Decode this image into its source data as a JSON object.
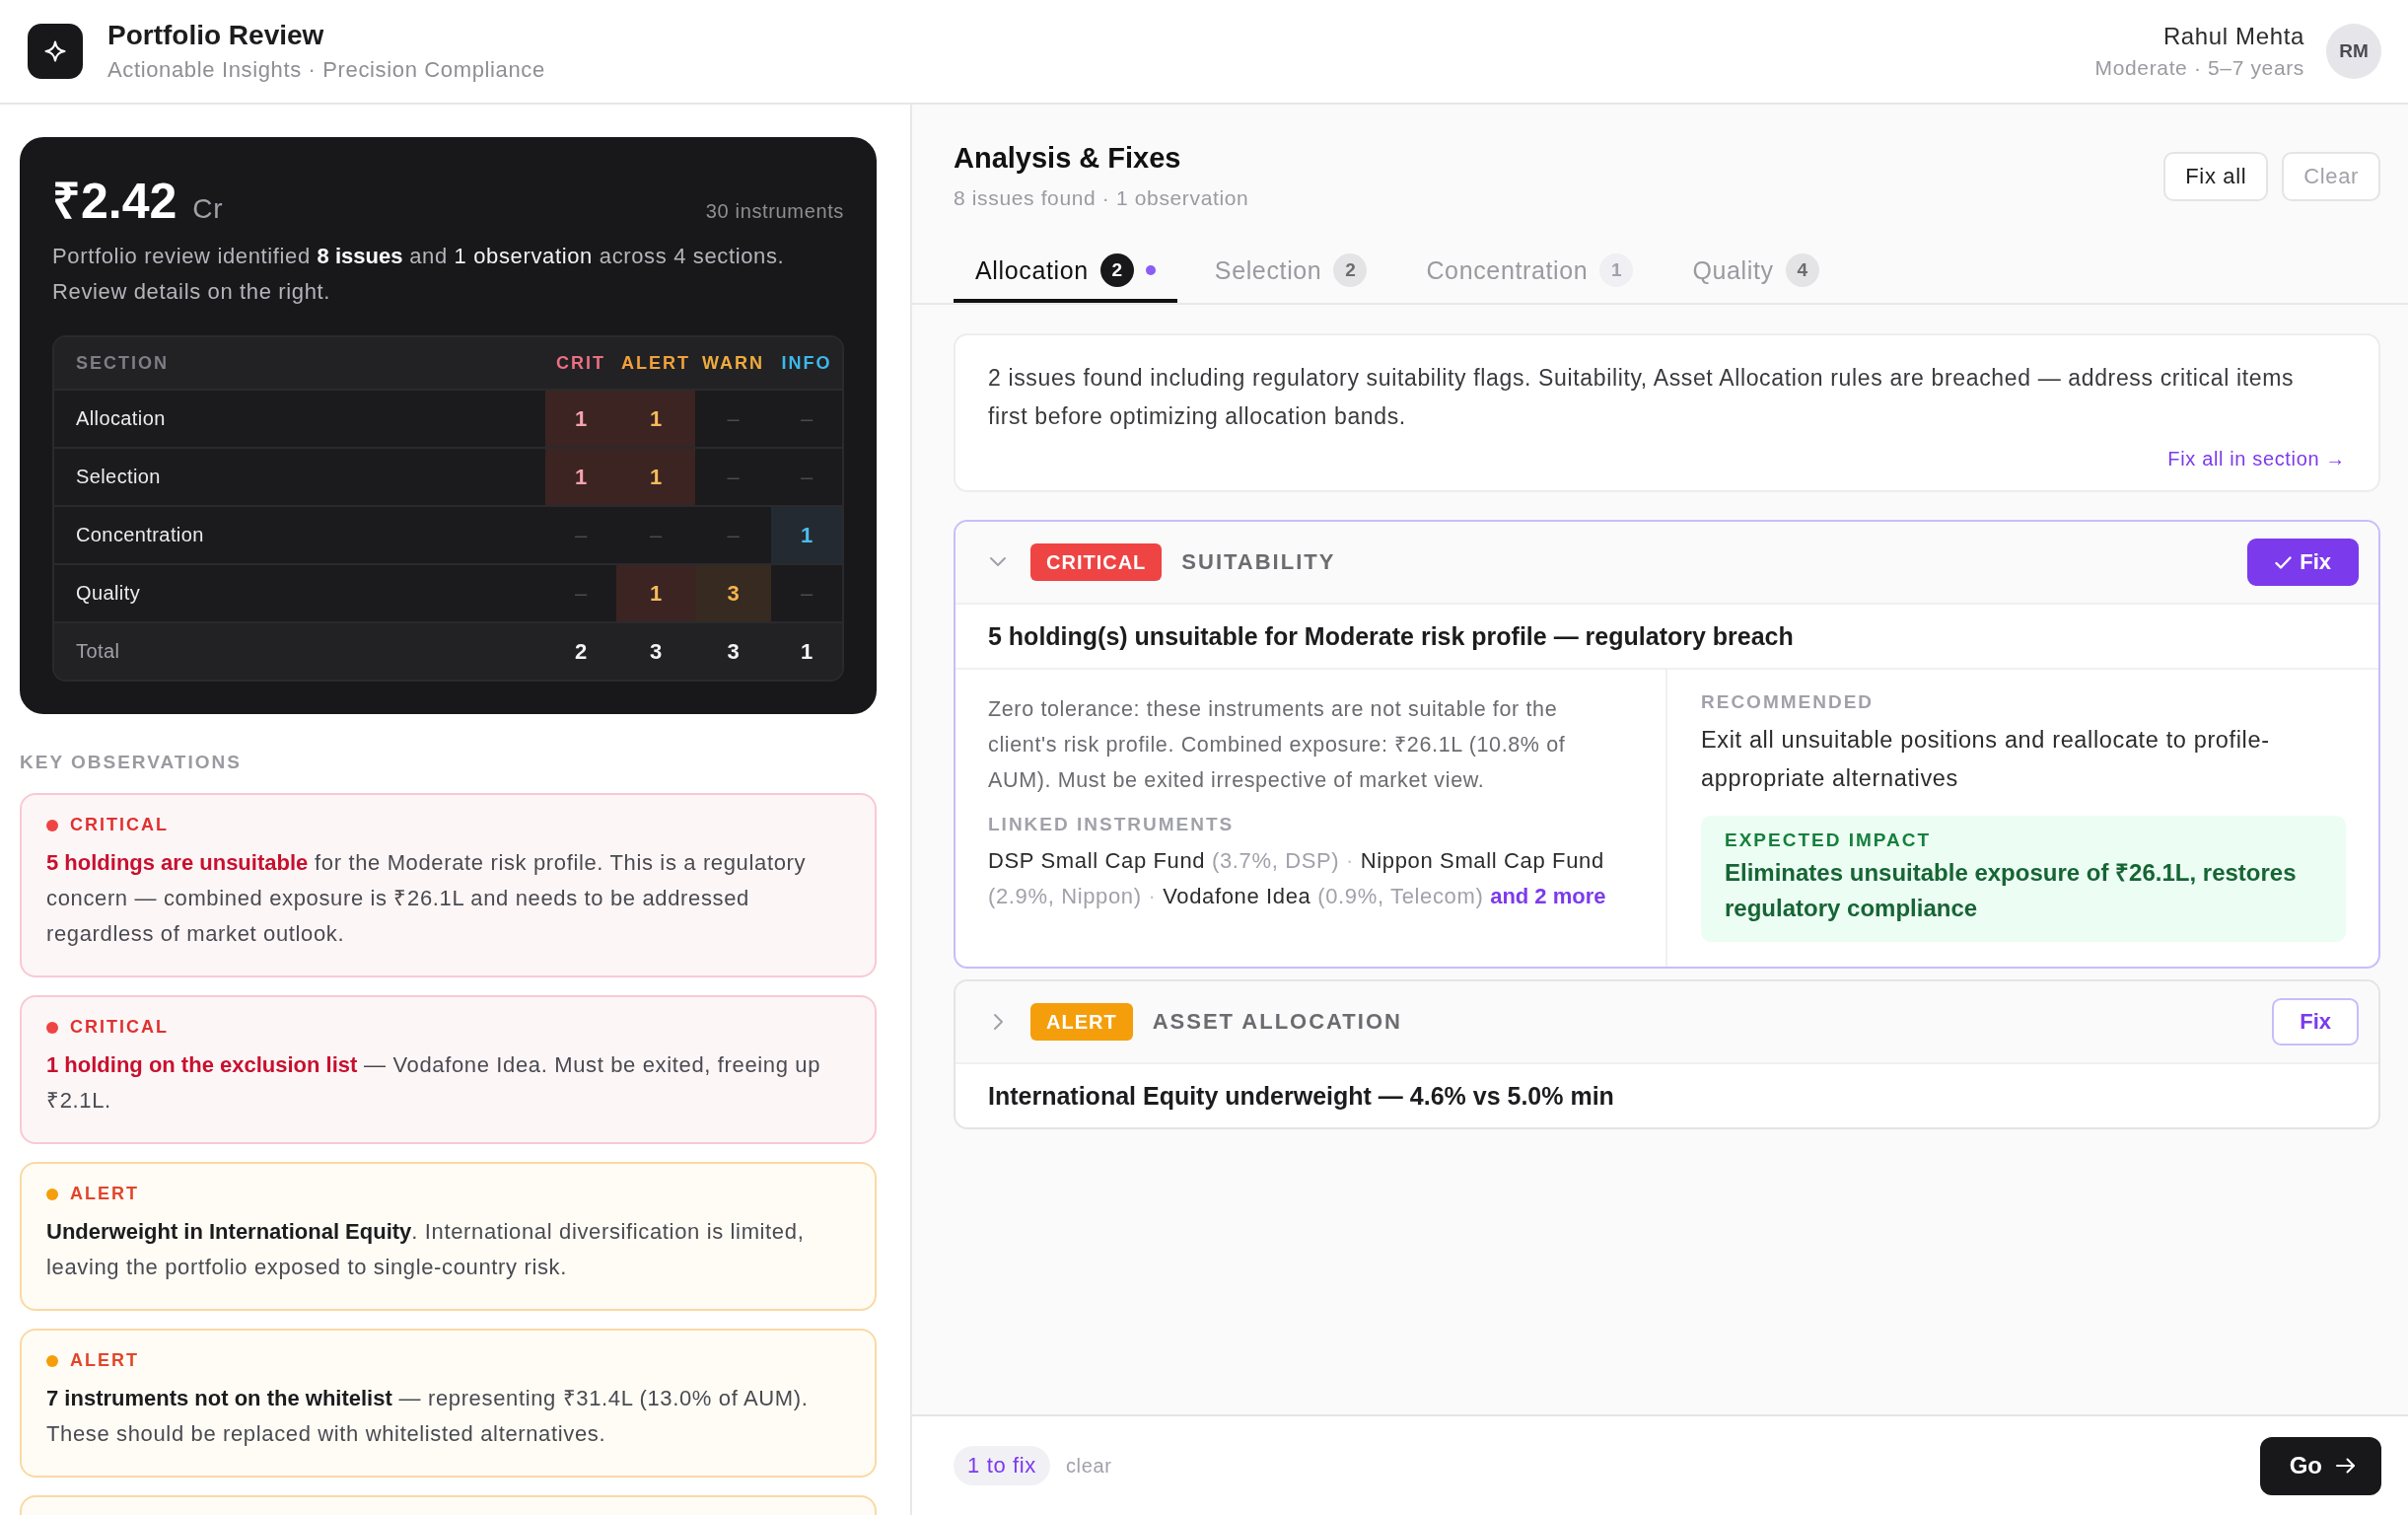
{
  "header": {
    "title": "Portfolio Review",
    "subtitle": "Actionable Insights · Precision Compliance",
    "user": {
      "name": "Rahul Mehta",
      "detail": "Moderate · 5–7 years",
      "initials": "RM"
    }
  },
  "summary_card": {
    "amount": "₹2.42",
    "unit": "Cr",
    "instruments": "30 instruments",
    "text_parts": [
      {
        "text": "Portfolio review identified ",
        "kind": "plain"
      },
      {
        "text": "8 issues",
        "kind": "strong"
      },
      {
        "text": " and ",
        "kind": "plain"
      },
      {
        "text": "1 observation",
        "kind": "emphasis"
      },
      {
        "text": " across 4 sections. Review details on the right.",
        "kind": "plain"
      }
    ],
    "table": {
      "section_header": "SECTION",
      "columns": [
        {
          "label": "CRIT",
          "kind": "critical"
        },
        {
          "label": "ALERT",
          "kind": "alert"
        },
        {
          "label": "WARN",
          "kind": "warning"
        },
        {
          "label": "INFO",
          "kind": "info"
        }
      ],
      "rows": [
        {
          "section": "Allocation",
          "cells": [
            {
              "text": "1",
              "active": true
            },
            {
              "text": "1",
              "active": true
            },
            {
              "text": "–",
              "active": false
            },
            {
              "text": "–",
              "active": false
            }
          ]
        },
        {
          "section": "Selection",
          "cells": [
            {
              "text": "1",
              "active": true
            },
            {
              "text": "1",
              "active": true
            },
            {
              "text": "–",
              "active": false
            },
            {
              "text": "–",
              "active": false
            }
          ]
        },
        {
          "section": "Concentration",
          "cells": [
            {
              "text": "–",
              "active": false
            },
            {
              "text": "–",
              "active": false
            },
            {
              "text": "–",
              "active": false
            },
            {
              "text": "1",
              "active": true
            }
          ]
        },
        {
          "section": "Quality",
          "cells": [
            {
              "text": "–",
              "active": false
            },
            {
              "text": "1",
              "active": true
            },
            {
              "text": "3",
              "active": true
            },
            {
              "text": "–",
              "active": false
            }
          ]
        }
      ],
      "total": {
        "label": "Total",
        "cells": [
          "2",
          "3",
          "3",
          "1"
        ]
      }
    }
  },
  "key_observations": {
    "title": "KEY OBSERVATIONS",
    "items": [
      {
        "kind": "critical",
        "label": "CRITICAL",
        "text": "**5 holdings are unsuitable** for the Moderate risk profile. This is a regulatory concern — combined exposure is ₹26.1L and needs to be addressed regardless of market outlook."
      },
      {
        "kind": "critical",
        "label": "CRITICAL",
        "text": "**1 holding on the exclusion list** — Vodafone Idea. Must be exited, freeing up ₹2.1L."
      },
      {
        "kind": "alert",
        "label": "ALERT",
        "text": "**Underweight in International Equity**. International diversification is limited, leaving the portfolio exposed to single-country risk."
      },
      {
        "kind": "alert",
        "label": "ALERT",
        "text": "**7 instruments not on the whitelist** — representing ₹31.4L (13.0% of AUM). These should be replaced with whitelisted alternatives."
      },
      {
        "kind": "warning"
      }
    ]
  },
  "analysis": {
    "title": "Analysis & Fixes",
    "subtitle": "8 issues found · 1 observation",
    "actions": [
      {
        "label": "Fix all",
        "disabled": false
      },
      {
        "label": "Clear",
        "disabled": true
      }
    ],
    "tabs": [
      {
        "label": "Allocation",
        "count": "2",
        "kind": "issues",
        "selected": true,
        "marked": true
      },
      {
        "label": "Selection",
        "count": "2",
        "kind": "issues",
        "selected": false,
        "marked": false
      },
      {
        "label": "Concentration",
        "count": "1",
        "kind": "observations",
        "selected": false,
        "marked": false
      },
      {
        "label": "Quality",
        "count": "4",
        "kind": "issues",
        "selected": false,
        "marked": false
      }
    ],
    "section_summary": {
      "text": "2 issues found including regulatory suitability flags. Suitability, Asset Allocation rules are breached — address critical items first before optimizing allocation bands.",
      "link": "Fix all in section →"
    },
    "issues": [
      {
        "kind": "critical",
        "badge": "CRITICAL",
        "category": "SUITABILITY",
        "fix_label": "Fix",
        "fix_selected": true,
        "expanded": true,
        "title": "5 holding(s) unsuitable for Moderate risk profile — regulatory breach",
        "description": "Zero tolerance: these instruments are not suitable for the client's risk profile. Combined exposure: ₹26.1L (10.8% of AUM). Must be exited irrespective of market view.",
        "linked_label": "LINKED INSTRUMENTS",
        "instruments": [
          {
            "name": "DSP Small Cap Fund",
            "detail": "(3.7%, DSP)",
            "separator": "·"
          },
          {
            "name": "Nippon Small Cap Fund",
            "detail": "(2.9%, Nippon)",
            "separator": "·"
          },
          {
            "name": "Vodafone Idea",
            "detail": "(0.9%, Telecom)"
          }
        ],
        "more": "and 2 more",
        "recommended_label": "RECOMMENDED",
        "recommendation": "Exit all unsuitable positions and reallocate to profile-appropriate alternatives",
        "impact_label": "EXPECTED IMPACT",
        "impact": "Eliminates unsuitable exposure of ₹26.1L, restores regulatory compliance"
      },
      {
        "kind": "alert",
        "badge": "ALERT",
        "category": "ASSET ALLOCATION",
        "fix_label": "Fix",
        "fix_selected": false,
        "expanded": false,
        "title": "International Equity underweight — 4.6% vs 5.0% min"
      }
    ]
  },
  "footer": {
    "pending": "1 to fix",
    "clear": "clear",
    "go": "Go"
  }
}
